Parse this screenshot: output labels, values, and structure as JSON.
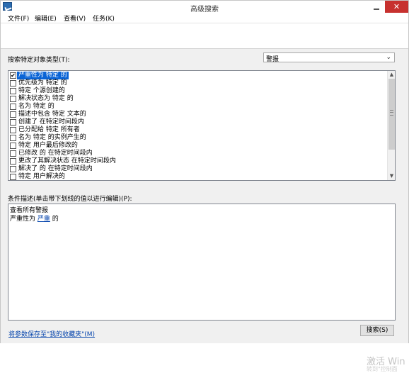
{
  "window": {
    "title": "高级搜索",
    "close_symbol": "✕"
  },
  "menu": {
    "items": [
      "文件(F)",
      "编辑(E)",
      "查看(V)",
      "任务(K)"
    ]
  },
  "search_type": {
    "label": "搜索特定对象类型(T):",
    "selected": "警报"
  },
  "criteria_list": {
    "items": [
      {
        "label": "严重性为 特定 的",
        "checked": true,
        "selected": true
      },
      {
        "label": "优先级为 特定 的",
        "checked": false
      },
      {
        "label": "特定 个源创建的",
        "checked": false
      },
      {
        "label": "解决状态为 特定  的",
        "checked": false
      },
      {
        "label": "名为 特定 的",
        "checked": false
      },
      {
        "label": "描述中包含 特定 文本的",
        "checked": false
      },
      {
        "label": "创建了 在特定时间段内",
        "checked": false
      },
      {
        "label": "已分配给 特定 所有者",
        "checked": false
      },
      {
        "label": "名为 特定 的实例产生的",
        "checked": false
      },
      {
        "label": "特定 用户最后修改的",
        "checked": false
      },
      {
        "label": "已修改  的 在特定时间段内",
        "checked": false
      },
      {
        "label": "更改了其解决状态 在特定时间段内",
        "checked": false
      },
      {
        "label": "解决了  的 在特定时间段内",
        "checked": false
      },
      {
        "label": "特定 用户解决的",
        "checked": false
      }
    ],
    "scroll_up": "▲",
    "scroll_down": "▼"
  },
  "description": {
    "label": "条件描述(单击带下划线的值以进行编辑)(P):",
    "line1": "查看所有警报",
    "line2_prefix": "严重性为 ",
    "line2_link": "严重",
    "line2_suffix": " 的"
  },
  "footer": {
    "save_link": "将参数保存至\"我的收藏夹\"(M)",
    "search_button": "搜索(S)"
  },
  "watermark": {
    "line1": "激活 Win",
    "line2": "转到\"控制面"
  }
}
